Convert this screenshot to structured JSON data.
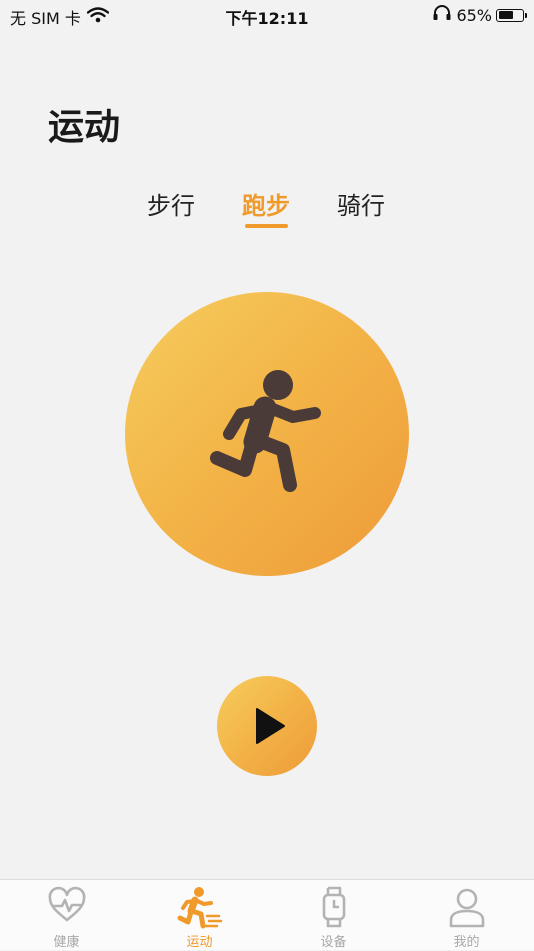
{
  "status_bar": {
    "carrier": "无 SIM 卡",
    "time": "下午12:11",
    "battery": "65%",
    "battery_level": 0.65,
    "icons": [
      "wifi-icon",
      "headphones-icon",
      "battery-icon"
    ]
  },
  "page": {
    "title": "运动"
  },
  "sport_tabs": [
    {
      "label": "步行",
      "active": false
    },
    {
      "label": "跑步",
      "active": true
    },
    {
      "label": "骑行",
      "active": false
    }
  ],
  "hero": {
    "icon": "running-person-icon"
  },
  "start_button": {
    "icon": "play-icon"
  },
  "colors": {
    "accent": "#f09a2c",
    "gradient_start": "#f6cd5e",
    "gradient_end": "#ee9b38",
    "figure": "#4a3a38",
    "inactive_tab": "#a8a8a8",
    "background": "#f2f2f2"
  },
  "tab_bar": {
    "items": [
      {
        "label": "健康",
        "icon": "heart-pulse-icon",
        "active": false
      },
      {
        "label": "运动",
        "icon": "runner-icon",
        "active": true
      },
      {
        "label": "设备",
        "icon": "smartwatch-icon",
        "active": false
      },
      {
        "label": "我的",
        "icon": "person-icon",
        "active": false
      }
    ]
  }
}
